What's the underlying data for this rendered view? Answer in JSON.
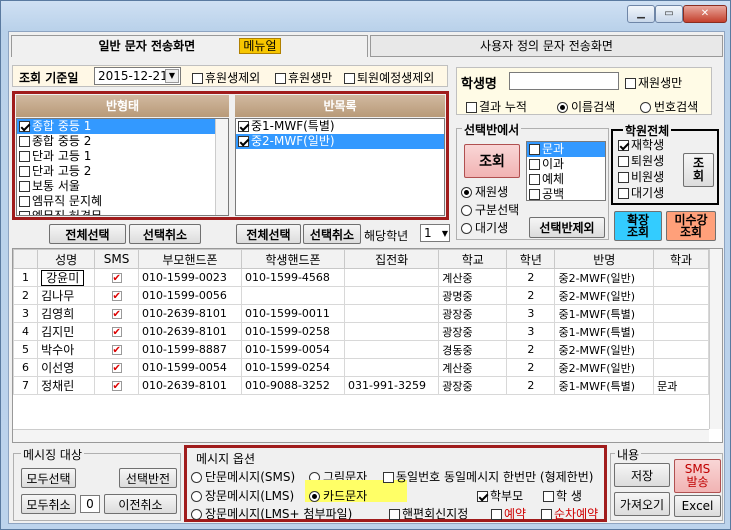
{
  "tabs": {
    "main": "일반 문자 전송화면",
    "menu": "메뉴얼",
    "custom": "사용자 정의 문자 전송화면"
  },
  "query": {
    "label": "조회 기준일",
    "date": "2015-12-21",
    "opt1": "휴원생제외",
    "opt2": "휴원생만",
    "opt3": "퇴원예정생제외"
  },
  "student": {
    "label": "학생명",
    "value": "",
    "enrolled_only": "재원생만",
    "accum": "결과 누적",
    "name_search": "이름검색",
    "num_search": "번호검색"
  },
  "class_type": {
    "header": "반형태",
    "items": [
      {
        "label": "종합 중등 1",
        "checked": true,
        "selected": true
      },
      {
        "label": "종합 중등 2",
        "checked": false
      },
      {
        "label": "단과 고등 1",
        "checked": false
      },
      {
        "label": "단과 고등 2",
        "checked": false
      },
      {
        "label": "보통 서울",
        "checked": false
      },
      {
        "label": "엠뮤직 문지혜",
        "checked": false
      },
      {
        "label": "엠뮤직 허경무",
        "checked": false
      }
    ]
  },
  "class_list": {
    "header": "반목록",
    "items": [
      {
        "label": "중1-MWF(특별)",
        "checked": true,
        "selected": false
      },
      {
        "label": "중2-MWF(일반)",
        "checked": true,
        "selected": true
      }
    ]
  },
  "buttons": {
    "select_all": "전체선택",
    "cancel_sel": "선택취소",
    "select_all2": "전체선택",
    "cancel_sel2": "선택취소",
    "grade_label": "해당학년",
    "grade_val": "1",
    "query": "조회",
    "exclude": "선택반제외",
    "expand": "확장\n조회",
    "unpaid": "미수강\n조회",
    "view": "조\n회"
  },
  "select_class": {
    "title": "선택반에서",
    "subjects": [
      {
        "label": "문과",
        "checked": false,
        "selected": true
      },
      {
        "label": "이과",
        "checked": false
      },
      {
        "label": "예체",
        "checked": false
      },
      {
        "label": "공백",
        "checked": false
      }
    ],
    "r1": "재원생",
    "r2": "구분선택",
    "r3": "대기생"
  },
  "academy": {
    "title": "학원전체",
    "items": [
      {
        "label": "재학생",
        "checked": true
      },
      {
        "label": "퇴원생",
        "checked": false
      },
      {
        "label": "비원생",
        "checked": false
      },
      {
        "label": "대기생",
        "checked": false
      }
    ]
  },
  "grid": {
    "headers": [
      "",
      "성명",
      "SMS",
      "부모핸드폰",
      "학생핸드폰",
      "집전화",
      "학교",
      "학년",
      "반명",
      "학과"
    ],
    "rows": [
      [
        "1",
        "강윤미",
        "✔",
        "010-1599-0023",
        "010-1599-4568",
        "",
        "계산중",
        "2",
        "중2-MWF(일반)",
        ""
      ],
      [
        "2",
        "김나무",
        "✔",
        "010-1599-0056",
        "",
        "",
        "광명중",
        "2",
        "중2-MWF(일반)",
        ""
      ],
      [
        "3",
        "김영희",
        "✔",
        "010-2639-8101",
        "010-1599-0011",
        "",
        "광장중",
        "3",
        "중1-MWF(특별)",
        ""
      ],
      [
        "4",
        "김지민",
        "✔",
        "010-2639-8101",
        "010-1599-0258",
        "",
        "광장중",
        "3",
        "중1-MWF(특별)",
        ""
      ],
      [
        "5",
        "박수아",
        "✔",
        "010-1599-8887",
        "010-1599-0054",
        "",
        "경동중",
        "2",
        "중2-MWF(일반)",
        ""
      ],
      [
        "6",
        "이선영",
        "✔",
        "010-1599-0054",
        "010-1599-0254",
        "",
        "계산중",
        "2",
        "중2-MWF(일반)",
        ""
      ],
      [
        "7",
        "정채린",
        "✔",
        "010-2639-8101",
        "010-9088-3252",
        "031-991-3259",
        "광장중",
        "2",
        "중1-MWF(특별)",
        "문과"
      ]
    ]
  },
  "target": {
    "title": "메시징 대상",
    "select_all": "모두선택",
    "reverse": "선택반전",
    "cancel_all": "모두취소",
    "count": "0",
    "prev_cancel": "이전취소"
  },
  "msg": {
    "title": "메시지 옵션",
    "o1": "단문메시지(SMS)",
    "o2": "그림문자",
    "o3": "장문메시지(LMS)",
    "o4": "카드문자",
    "o5": "장문메시지(LMS+ 첨부파일)",
    "same": "동일번호 동일메시지 한번만 (형제한번)",
    "parent": "학부모",
    "student": "학 생",
    "hp": "핸편회신지정",
    "reserve": "예약",
    "seq": "순차예약"
  },
  "content": {
    "title": "내용",
    "save": "저장",
    "load": "가져오기",
    "sms_send": "SMS\n발송",
    "excel": "Excel"
  }
}
